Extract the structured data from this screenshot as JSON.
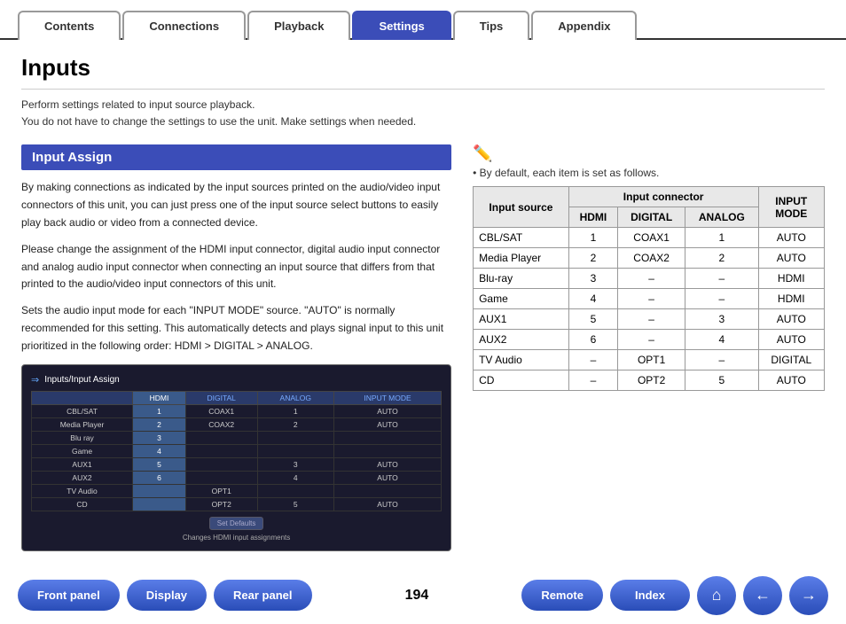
{
  "tabs": [
    {
      "id": "contents",
      "label": "Contents",
      "active": false
    },
    {
      "id": "connections",
      "label": "Connections",
      "active": false
    },
    {
      "id": "playback",
      "label": "Playback",
      "active": false
    },
    {
      "id": "settings",
      "label": "Settings",
      "active": true
    },
    {
      "id": "tips",
      "label": "Tips",
      "active": false
    },
    {
      "id": "appendix",
      "label": "Appendix",
      "active": false
    }
  ],
  "page": {
    "title": "Inputs",
    "subtitle_line1": "Perform settings related to input source playback.",
    "subtitle_line2": "You do not have to change the settings to use the unit. Make settings when needed."
  },
  "section": {
    "header": "Input Assign",
    "body1": "By making connections as indicated by the input sources printed on the audio/video input connectors of this unit, you can just press one of the input source select buttons to easily play back audio or video from a connected device.",
    "body2": "Please change the assignment of the HDMI input connector, digital audio input connector and analog audio input connector when connecting an input source that differs from that printed to the audio/video input connectors of this unit.",
    "body3": "Sets the audio input mode for each \"INPUT MODE\" source. \"AUTO\" is normally recommended for this setting. This automatically detects and plays signal input to this unit prioritized in the following order: HDMI > DIGITAL > ANALOG."
  },
  "screenshot": {
    "title": "Inputs/Input Assign",
    "columns": [
      "HDMI",
      "DIGITAL",
      "ANALOG",
      "INPUT MODE"
    ],
    "rows": [
      {
        "source": "CBL/SAT",
        "hdmi": "1",
        "digital": "COAX1",
        "analog": "1",
        "mode": "AUTO"
      },
      {
        "source": "Media Player",
        "hdmi": "2",
        "digital": "COAX2",
        "analog": "2",
        "mode": "AUTO"
      },
      {
        "source": "Blu ray",
        "hdmi": "3",
        "digital": "",
        "analog": "",
        "mode": ""
      },
      {
        "source": "Game",
        "hdmi": "4",
        "digital": "",
        "analog": "",
        "mode": ""
      },
      {
        "source": "AUX1",
        "hdmi": "5",
        "digital": "",
        "analog": "3",
        "mode": "AUTO"
      },
      {
        "source": "AUX2",
        "hdmi": "6",
        "digital": "",
        "analog": "4",
        "mode": "AUTO"
      },
      {
        "source": "TV Audio",
        "hdmi": "",
        "digital": "OPT1",
        "analog": "",
        "mode": ""
      },
      {
        "source": "CD",
        "hdmi": "",
        "digital": "OPT2",
        "analog": "5",
        "mode": "AUTO"
      }
    ],
    "btn_label": "Set Defaults",
    "note": "Changes HDMI input assignments"
  },
  "right": {
    "note_label": "• By default, each item is set as follows.",
    "table": {
      "header_row1": [
        "Input source",
        "Input connector",
        "",
        "",
        "INPUT MODE"
      ],
      "header_row2": [
        "",
        "HDMI",
        "DIGITAL",
        "ANALOG",
        ""
      ],
      "rows": [
        {
          "source": "CBL/SAT",
          "hdmi": "1",
          "digital": "COAX1",
          "analog": "1",
          "mode": "AUTO"
        },
        {
          "source": "Media Player",
          "hdmi": "2",
          "digital": "COAX2",
          "analog": "2",
          "mode": "AUTO"
        },
        {
          "source": "Blu-ray",
          "hdmi": "3",
          "digital": "–",
          "analog": "–",
          "mode": "HDMI"
        },
        {
          "source": "Game",
          "hdmi": "4",
          "digital": "–",
          "analog": "–",
          "mode": "HDMI"
        },
        {
          "source": "AUX1",
          "hdmi": "5",
          "digital": "–",
          "analog": "3",
          "mode": "AUTO"
        },
        {
          "source": "AUX2",
          "hdmi": "6",
          "digital": "–",
          "analog": "4",
          "mode": "AUTO"
        },
        {
          "source": "TV Audio",
          "hdmi": "–",
          "digital": "OPT1",
          "analog": "–",
          "mode": "DIGITAL"
        },
        {
          "source": "CD",
          "hdmi": "–",
          "digital": "OPT2",
          "analog": "5",
          "mode": "AUTO"
        }
      ]
    }
  },
  "bottom_nav": {
    "page_number": "194",
    "buttons": [
      {
        "id": "front-panel",
        "label": "Front panel"
      },
      {
        "id": "display",
        "label": "Display"
      },
      {
        "id": "rear-panel",
        "label": "Rear panel"
      },
      {
        "id": "remote",
        "label": "Remote"
      },
      {
        "id": "index",
        "label": "Index"
      }
    ],
    "home_icon": "⌂",
    "back_icon": "←",
    "forward_icon": "→"
  }
}
